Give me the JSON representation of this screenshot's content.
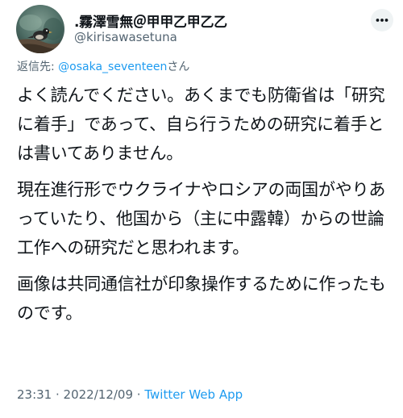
{
  "user": {
    "display_name": ".霧澤雪無＠甲甲乙甲乙乙",
    "handle": "@kirisawasetuna",
    "avatar_icon": "bird-photo-avatar"
  },
  "more_icon": "more-icon",
  "reply": {
    "prefix": "返信先: ",
    "mention": "@osaka_seventeen",
    "suffix": "さん"
  },
  "tweet": {
    "paragraphs": [
      "よく読んでください。あくまでも防衛省は「研究に着手」であって、自ら行うための研究に着手とは書いてありません。",
      "現在進行形でウクライナやロシアの両国がやりあっていたり、他国から（主に中露韓）からの世論工作への研究だと思われます。",
      "画像は共同通信社が印象操作するために作ったものです。"
    ]
  },
  "meta": {
    "time": "23:31",
    "sep1": " · ",
    "date": "2022/12/09",
    "sep2": " · ",
    "source": "Twitter Web App"
  },
  "colors": {
    "text": "#0f1419",
    "secondary": "#536471",
    "link": "#1d9bf0"
  }
}
